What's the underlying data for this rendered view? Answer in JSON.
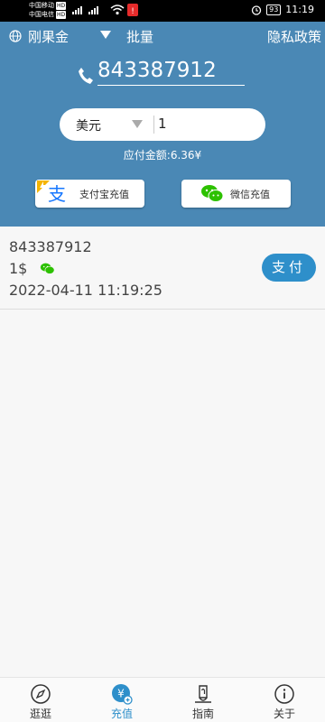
{
  "status": {
    "carrier1": "中国移动",
    "carrier2": "中国电信",
    "hd": "HD",
    "battery": "93",
    "time": "11:19"
  },
  "topbar": {
    "app_name": "刚果金",
    "batch": "批量",
    "privacy": "隐私政策"
  },
  "form": {
    "phone": "843387912",
    "currency": "美元",
    "amount": "1",
    "payable": "应付金额:6.36¥"
  },
  "buttons": {
    "alipay": "支付宝充值",
    "wechat": "微信充值"
  },
  "records": [
    {
      "phone": "843387912",
      "amount": "1$",
      "time": "2022-04-11 11:19:25",
      "pay_label": "支付"
    }
  ],
  "nav": [
    {
      "label": "逛逛",
      "icon": "compass-icon"
    },
    {
      "label": "充值",
      "icon": "recharge-icon",
      "active": true
    },
    {
      "label": "指南",
      "icon": "guide-icon"
    },
    {
      "label": "关于",
      "icon": "info-icon"
    }
  ],
  "colors": {
    "header": "#4a88b5",
    "accent": "#2e8fca",
    "wechat": "#2dc100",
    "alipay": "#1677ff"
  }
}
